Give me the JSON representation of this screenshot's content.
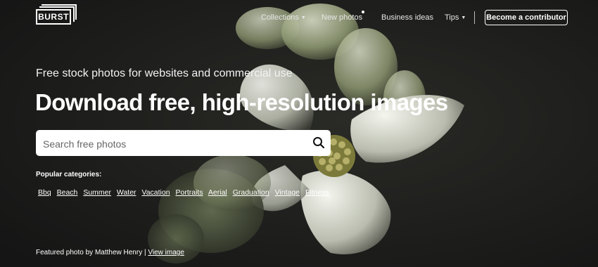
{
  "logo": {
    "text": "BURST"
  },
  "nav": {
    "items": [
      {
        "label": "Collections",
        "has_caret": true
      },
      {
        "label": "New photos",
        "has_dot": true
      },
      {
        "label": "Business ideas"
      },
      {
        "label": "Tips",
        "has_caret": true
      }
    ],
    "cta_label": "Become a contributor"
  },
  "hero": {
    "tagline": "Free stock photos for websites and commercial use",
    "headline": "Download free, high-resolution images",
    "search": {
      "placeholder": "Search free photos",
      "value": ""
    }
  },
  "categories": {
    "label": "Popular categories:",
    "items": [
      "Bbq",
      "Beach",
      "Summer",
      "Water",
      "Vacation",
      "Portraits",
      "Aerial",
      "Graduation",
      "Vintage",
      "Fitness"
    ]
  },
  "credit": {
    "prefix": "Featured photo by Matthew Henry",
    "separator": "|",
    "link_label": "View image"
  },
  "colors": {
    "background": "#1b1b1b",
    "flower_petal": "#e6e9dc",
    "flower_green": "#a9b38a"
  }
}
